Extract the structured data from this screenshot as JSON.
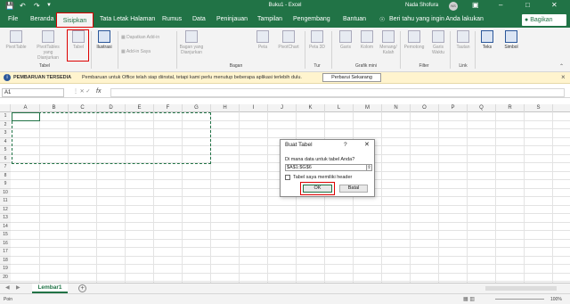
{
  "titlebar": {
    "title": "Buku1  -  Excel",
    "user": "Nada Shofura",
    "avatar_initials": "NS",
    "save_icon": "save-icon",
    "undo_icon": "undo-icon",
    "redo_icon": "redo-icon"
  },
  "tabs": [
    "File",
    "Beranda",
    "Sisipkan",
    "Tata Letak Halaman",
    "Rumus",
    "Data",
    "Peninjauan",
    "Tampilan",
    "Pengembang",
    "Bantuan"
  ],
  "tell_me": "Beri tahu yang ingin Anda lakukan",
  "share_label": "Bagikan",
  "ribbon": {
    "buttons": [
      {
        "label": "PivotTable",
        "icon": "pivottable-icon"
      },
      {
        "label": "PivotTables yang Dianjurkan",
        "icon": "recommended-pivottable-icon"
      },
      {
        "label": "Tabel",
        "icon": "table-icon"
      },
      {
        "label": "Ilustrasi",
        "icon": "illustrations-icon"
      },
      {
        "label": "Dapatkan Add-in",
        "icon": "get-addins-icon"
      },
      {
        "label": "Add-in Saya",
        "icon": "my-addins-icon"
      },
      {
        "label": "Bagan yang Dianjurkan",
        "icon": "recommended-charts-icon"
      },
      {
        "label": "Peta",
        "icon": "maps-icon"
      },
      {
        "label": "PivotChart",
        "icon": "pivotchart-icon"
      },
      {
        "label": "Peta 3D",
        "icon": "3d-map-icon"
      },
      {
        "label": "Garis",
        "icon": "line-sparkline-icon"
      },
      {
        "label": "Kolom",
        "icon": "column-sparkline-icon"
      },
      {
        "label": "Menang/ Kalah",
        "icon": "winloss-icon"
      },
      {
        "label": "Pemotong",
        "icon": "slicer-icon"
      },
      {
        "label": "Garis Waktu",
        "icon": "timeline-icon"
      },
      {
        "label": "Tautan",
        "icon": "link-icon"
      },
      {
        "label": "Teks",
        "icon": "text-icon"
      },
      {
        "label": "Simbol",
        "icon": "symbol-icon"
      }
    ],
    "groups": [
      "Tabel",
      "Bagan",
      "Tur",
      "Grafik mini",
      "Filter",
      "Link"
    ]
  },
  "message_bar": {
    "heading": "PEMBARUAN TERSEDIA",
    "text": "Pembaruan untuk Office telah siap diinstal, tetapi kami perlu menutup beberapa aplikasi terlebih dulu.",
    "button": "Perbarui Sekarang"
  },
  "formula_bar": {
    "name_box": "A1",
    "fx": "fx",
    "value": ""
  },
  "columns": [
    "A",
    "B",
    "C",
    "D",
    "E",
    "F",
    "G",
    "H",
    "I",
    "J",
    "K",
    "L",
    "M",
    "N",
    "O",
    "P",
    "Q",
    "R",
    "S"
  ],
  "rows": [
    "1",
    "2",
    "3",
    "4",
    "5",
    "6",
    "7",
    "8",
    "9",
    "10",
    "11",
    "12",
    "13",
    "14",
    "15",
    "16",
    "17",
    "18",
    "19",
    "20"
  ],
  "dialog": {
    "title": "Buat Tabel",
    "help": "?",
    "prompt": "Di mana data untuk tabel Anda?",
    "range_value": "$A$1:$G$6",
    "checkbox_label": "Tabel saya memiliki header",
    "checkbox_checked": false,
    "ok_label": "OK",
    "cancel_label": "Batal"
  },
  "sheet_tab": "Lembar1",
  "status": {
    "mode": "Poin",
    "zoom": "100%"
  }
}
